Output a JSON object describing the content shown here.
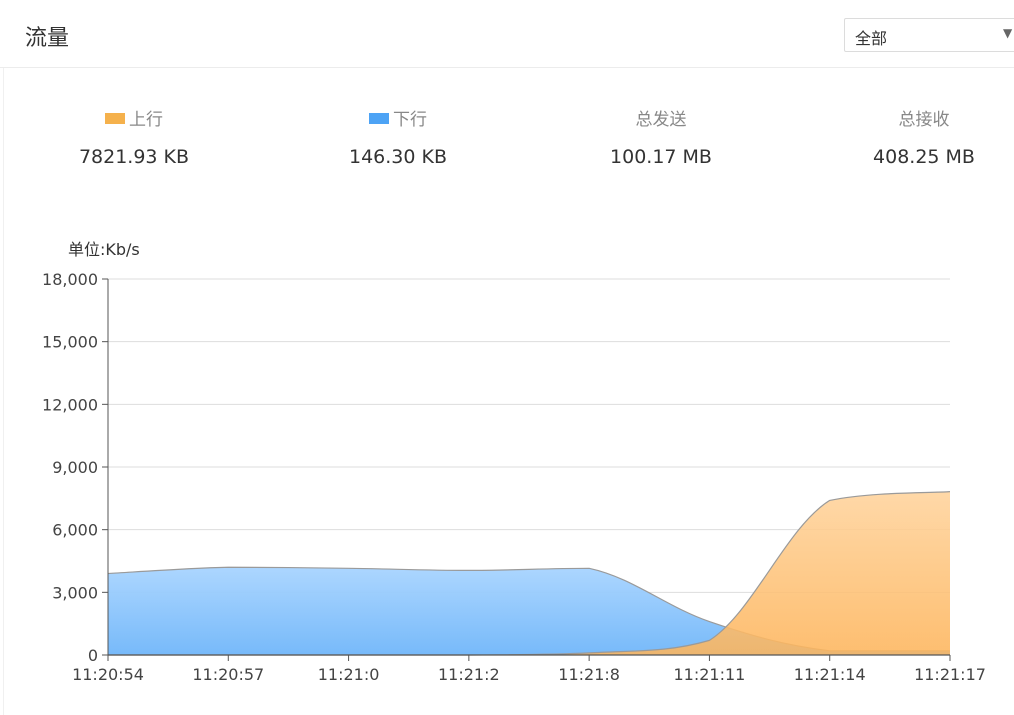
{
  "header": {
    "title": "流量",
    "filter": {
      "selected": "全部"
    }
  },
  "stats": [
    {
      "label": "上行",
      "value": "7821.93 KB",
      "legend_color": "#F5B14C"
    },
    {
      "label": "下行",
      "value": "146.30 KB",
      "legend_color": "#4DA3F5"
    },
    {
      "label": "总发送",
      "value": "100.17 MB"
    },
    {
      "label": "总接收",
      "value": "408.25 MB"
    }
  ],
  "chart_data": {
    "type": "area",
    "unit_label": "单位:Kb/s",
    "ylim": [
      0,
      18000
    ],
    "yticks": [
      0,
      3000,
      6000,
      9000,
      12000,
      15000,
      18000
    ],
    "ytick_labels": [
      "0",
      "3,000",
      "6,000",
      "9,000",
      "12,000",
      "15,000",
      "18,000"
    ],
    "categories": [
      "11:20:54",
      "11:20:57",
      "11:21:0",
      "11:21:2",
      "11:21:8",
      "11:21:11",
      "11:21:14",
      "11:21:17"
    ],
    "grid": true,
    "series": [
      {
        "name": "下行",
        "color": "#4DA3F5",
        "values": [
          3900,
          4200,
          4150,
          4050,
          4150,
          1600,
          200,
          200
        ]
      },
      {
        "name": "上行",
        "color": "#F5B14C",
        "values": [
          0,
          0,
          0,
          0,
          100,
          700,
          7400,
          7820
        ]
      }
    ]
  }
}
